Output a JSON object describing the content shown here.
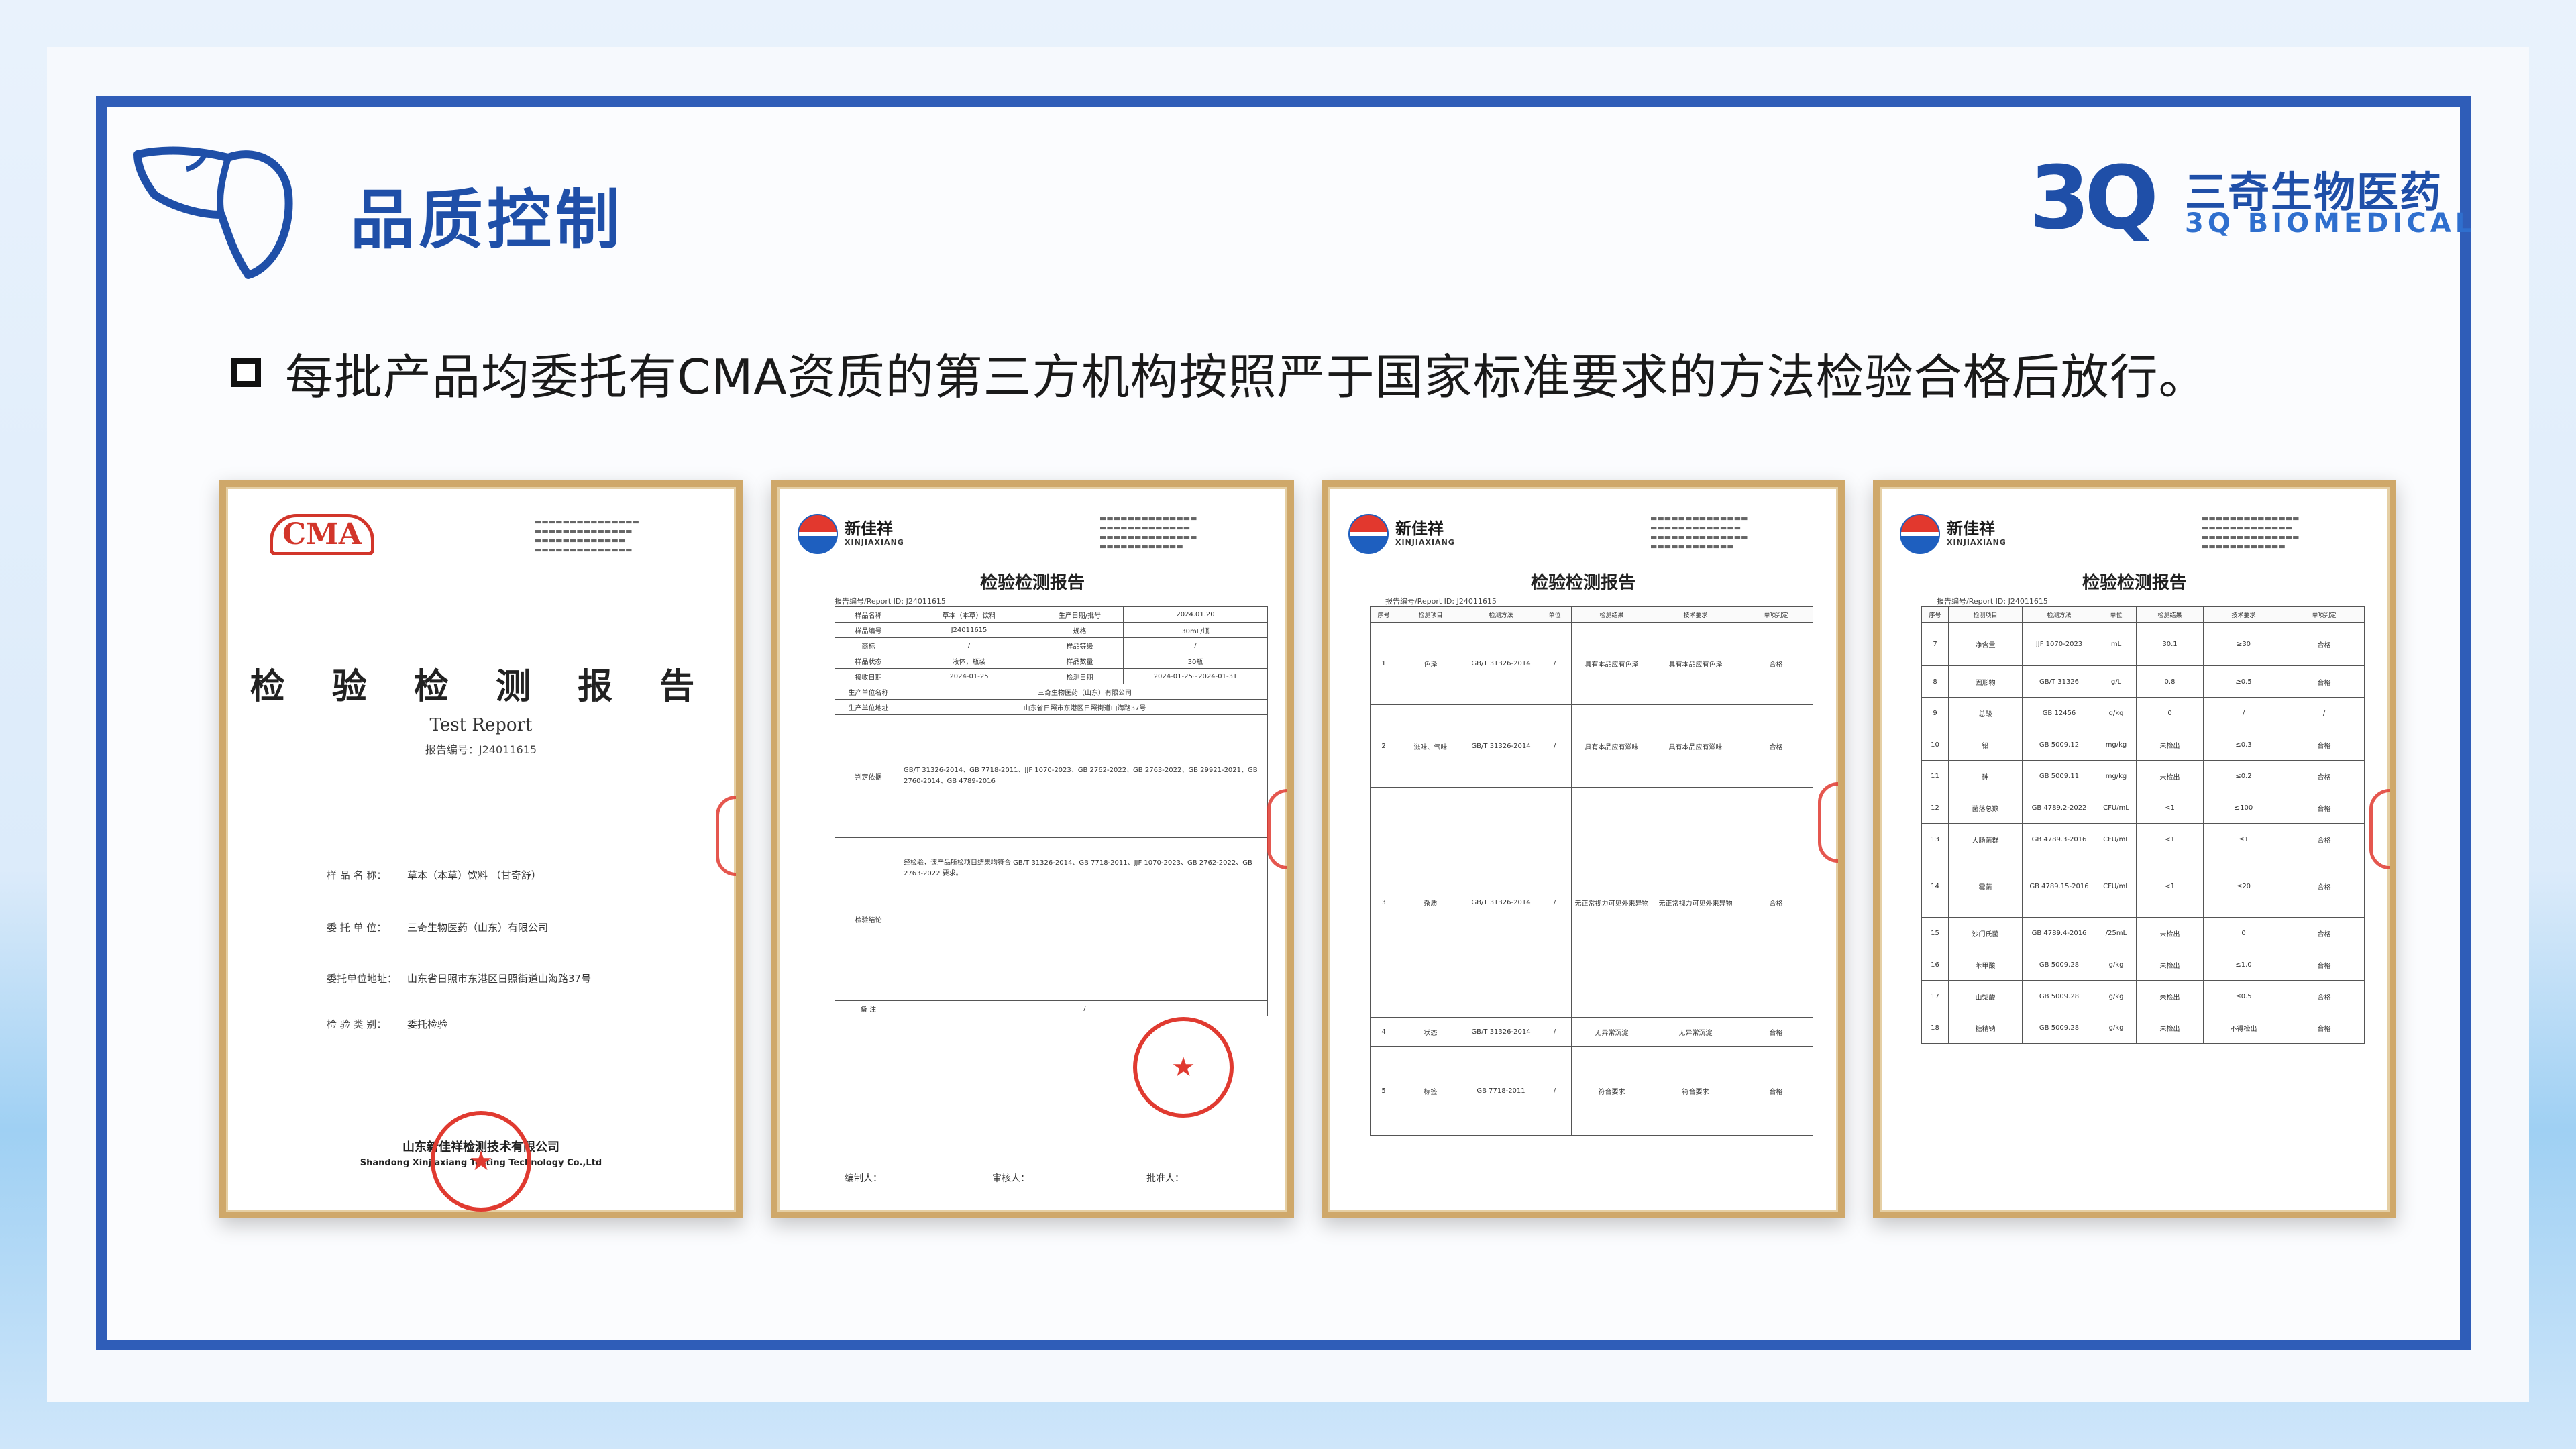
{
  "page": {
    "title": "品质控制",
    "brand_cn": "三奇生物医药",
    "brand_en": "3Q BIOMEDICAL",
    "brand_mark": "3Q",
    "statement": "每批产品均委托有CMA资质的第三方机构按照严于国家标准要求的方法检验合格后放行。"
  },
  "colors": {
    "accent": "#1f4fa8",
    "frame": "#2f5db8",
    "gold_border": "#cfa86a",
    "seal_red": "#e03a30"
  },
  "icons": {
    "left_logo": "liver-outline-icon",
    "bullet": "square-bullet-icon"
  },
  "doc1": {
    "cma": "CMA",
    "title": "检 验 检 测 报 告",
    "title_en": "Test Report",
    "report_no": "报告编号：J24011615",
    "fields": [
      {
        "label": "样 品 名 称：",
        "value": "草本（本草）饮料 （甘奇舒）"
      },
      {
        "label": "委 托 单 位：",
        "value": "三奇生物医药（山东）有限公司"
      },
      {
        "label": "委托单位地址：",
        "value": "山东省日照市东港区日照街道山海路37号"
      },
      {
        "label": "检 验 类 别：",
        "value": "委托检验"
      }
    ],
    "issuer_cn": "山东新佳祥检测技术有限公司",
    "issuer_en": "Shandong Xinjiaxiang Testing Technology Co.,Ltd"
  },
  "xjx": {
    "name": "新佳祥",
    "name_en": "XINJIAXIANG",
    "doc_title": "检验检测报告",
    "report_no": "报告编号/Report ID: J24011615"
  },
  "doc2": {
    "rows": [
      [
        "样品名称",
        "草本（本草）饮料",
        "生产日期/批号",
        "2024.01.20"
      ],
      [
        "样品编号",
        "J24011615",
        "规格",
        "30mL/瓶"
      ],
      [
        "商标",
        "/",
        "样品等级",
        "/"
      ],
      [
        "样品状态",
        "液体，瓶装",
        "样品数量",
        "30瓶"
      ],
      [
        "接收日期",
        "2024-01-25",
        "检测日期",
        "2024-01-25~2024-01-31"
      ]
    ],
    "maker": "三奇生物医药（山东）有限公司",
    "maker_addr": "山东省日照市东港区日照街道山海路37号",
    "basis": "GB/T 31326-2014、GB 7718-2011、JJF 1070-2023、GB 2762-2022、GB 2763-2022、GB 29921-2021、GB 2760-2014、GB 4789-2016",
    "conclusion": "经检验，该产品所检项目结果均符合 GB/T 31326-2014、GB 7718-2011、JJF 1070-2023、GB 2762-2022、GB 2763-2022 要求。",
    "signers": [
      "编制人：",
      "审核人：",
      "批准人："
    ]
  },
  "doc3": {
    "head": [
      "序号",
      "检测项目",
      "检测方法",
      "单位",
      "检测结果",
      "技术要求",
      "单项判定"
    ],
    "rows": [
      [
        "1",
        "色泽",
        "GB/T 31326-2014",
        "/",
        "具有本品应有色泽",
        "具有本品应有色泽",
        "合格"
      ],
      [
        "2",
        "滋味、气味",
        "GB/T 31326-2014",
        "/",
        "具有本品应有滋味",
        "具有本品应有滋味",
        "合格"
      ],
      [
        "3",
        "杂质",
        "GB/T 31326-2014",
        "/",
        "无正常视力可见外来异物",
        "无正常视力可见外来异物",
        "合格"
      ],
      [
        "4",
        "状态",
        "GB/T 31326-2014",
        "/",
        "无异常沉淀",
        "无异常沉淀",
        "合格"
      ],
      [
        "5",
        "标签",
        "GB 7718-2011",
        "/",
        "符合要求",
        "符合要求",
        "合格"
      ]
    ]
  },
  "doc4": {
    "head": [
      "序号",
      "检测项目",
      "检测方法",
      "单位",
      "检测结果",
      "技术要求",
      "单项判定"
    ],
    "rows": [
      [
        "7",
        "净含量",
        "JJF 1070-2023",
        "mL",
        "30.1",
        "≥30",
        "合格"
      ],
      [
        "8",
        "固形物",
        "GB/T 31326",
        "g/L",
        "0.8",
        "≥0.5",
        "合格"
      ],
      [
        "9",
        "总酸",
        "GB 12456",
        "g/kg",
        "0",
        "/",
        "/"
      ],
      [
        "10",
        "铅",
        "GB 5009.12",
        "mg/kg",
        "未检出",
        "≤0.3",
        "合格"
      ],
      [
        "11",
        "砷",
        "GB 5009.11",
        "mg/kg",
        "未检出",
        "≤0.2",
        "合格"
      ],
      [
        "12",
        "菌落总数",
        "GB 4789.2-2022",
        "CFU/mL",
        "<1",
        "≤100",
        "合格"
      ],
      [
        "13",
        "大肠菌群",
        "GB 4789.3-2016",
        "CFU/mL",
        "<1",
        "≤1",
        "合格"
      ],
      [
        "14",
        "霉菌",
        "GB 4789.15-2016",
        "CFU/mL",
        "<1",
        "≤20",
        "合格"
      ],
      [
        "15",
        "沙门氏菌",
        "GB 4789.4-2016",
        "/25mL",
        "未检出",
        "0",
        "合格"
      ],
      [
        "16",
        "苯甲酸",
        "GB 5009.28",
        "g/kg",
        "未检出",
        "≤1.0",
        "合格"
      ],
      [
        "17",
        "山梨酸",
        "GB 5009.28",
        "g/kg",
        "未检出",
        "≤0.5",
        "合格"
      ],
      [
        "18",
        "糖精钠",
        "GB 5009.28",
        "g/kg",
        "未检出",
        "不得检出",
        "合格"
      ]
    ]
  }
}
